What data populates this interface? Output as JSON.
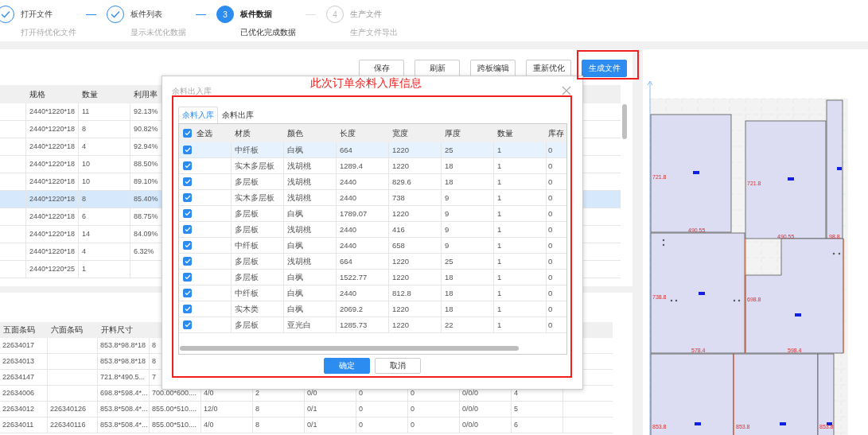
{
  "steps": [
    {
      "title": "打开文件",
      "subtitle": "打开待优化文件",
      "completed": true,
      "current": false
    },
    {
      "title": "板件列表",
      "subtitle": "显示未优化数据",
      "completed": true,
      "current": false
    },
    {
      "title": "板件数据",
      "subtitle": "已优化完成数据",
      "completed": false,
      "current": true,
      "number": "3"
    },
    {
      "title": "生产文件",
      "subtitle": "生产文件导出",
      "completed": false,
      "current": false,
      "number": "4"
    }
  ],
  "toolbar": [
    {
      "label": "保存",
      "kind": "default"
    },
    {
      "label": "刷新",
      "kind": "default"
    },
    {
      "label": "跨板编辑",
      "kind": "default"
    },
    {
      "label": "重新优化",
      "kind": "default"
    },
    {
      "label": "生成文件",
      "kind": "primary"
    }
  ],
  "board_table": {
    "columns": [
      "规格",
      "数量",
      "利用率"
    ],
    "rows": [
      {
        "cells": [
          "2440*1220*18",
          "11",
          "92.13%"
        ],
        "selected": false
      },
      {
        "cells": [
          "2440*1220*18",
          "8",
          "90.82%"
        ],
        "selected": false
      },
      {
        "cells": [
          "2440*1220*18",
          "4",
          "92.94%"
        ],
        "selected": false
      },
      {
        "cells": [
          "2440*1220*18",
          "10",
          "88.50%"
        ],
        "selected": false
      },
      {
        "cells": [
          "2440*1220*18",
          "10",
          "89.10%"
        ],
        "selected": false
      },
      {
        "cells": [
          "2440*1220*18",
          "8",
          "85.40%"
        ],
        "selected": true
      },
      {
        "cells": [
          "2440*1220*18",
          "6",
          "88.75%"
        ],
        "selected": false
      },
      {
        "cells": [
          "2440*1220*18",
          "14",
          "84.09%"
        ],
        "selected": false
      },
      {
        "cells": [
          "2440*1220*18",
          "4",
          "6.32%"
        ],
        "selected": false
      },
      {
        "cells": [
          "2440*1220*25",
          "1"
        ],
        "selected": false
      }
    ]
  },
  "part_table": {
    "columns": [
      "五面条码",
      "六面条码",
      "开料尺寸"
    ],
    "rows": [
      {
        "cells": [
          "22634017",
          null,
          "853.8*98.8*18",
          "8"
        ]
      },
      {
        "cells": [
          "22634013",
          null,
          "853.8*98.8*18",
          "8"
        ]
      },
      {
        "cells": [
          "22634147",
          null,
          "721.8*490.5...",
          "7"
        ]
      },
      {
        "cells": [
          "22634006",
          null,
          "698.8*598.4*...",
          "700.00*600....",
          "4/0",
          "2",
          "0/0",
          "0",
          "0",
          "0/0/0",
          "4"
        ]
      },
      {
        "cells": [
          "22634012",
          "226340126",
          "853.8*508.4*...",
          "855.00*510....",
          "12/0",
          "8",
          "0/1",
          "0",
          "0",
          "0/0/0",
          "5"
        ]
      },
      {
        "cells": [
          "22634011",
          "226340116",
          "853.8*508.4*...",
          "855.00*510....",
          "4/0",
          "8",
          "0/1",
          "0",
          "0",
          "0/0/0",
          "6"
        ]
      }
    ]
  },
  "modal": {
    "title": "余料出入库",
    "tabs": [
      {
        "label": "余料入库",
        "selected": true
      },
      {
        "label": "余料出库",
        "selected": false
      }
    ],
    "select_all": {
      "label": "全选",
      "checked": true
    },
    "columns": [
      "材质",
      "颜色",
      "长度",
      "宽度",
      "厚度",
      "数量",
      "库存"
    ],
    "rows": [
      {
        "checked": true,
        "selected": true,
        "cells": [
          "中纤板",
          "白枫",
          "664",
          "1220",
          "25",
          "1",
          "0"
        ]
      },
      {
        "checked": true,
        "selected": false,
        "cells": [
          "实木多层板",
          "浅胡桃",
          "1289.4",
          "1220",
          "18",
          "1",
          "0"
        ]
      },
      {
        "checked": true,
        "selected": false,
        "cells": [
          "多层板",
          "浅胡桃",
          "2440",
          "829.6",
          "18",
          "1",
          "0"
        ]
      },
      {
        "checked": true,
        "selected": false,
        "cells": [
          "实木多层板",
          "浅胡桃",
          "2440",
          "738",
          "9",
          "1",
          "0"
        ]
      },
      {
        "checked": true,
        "selected": false,
        "cells": [
          "多层板",
          "白枫",
          "1789.07",
          "1220",
          "9",
          "1",
          "0"
        ]
      },
      {
        "checked": true,
        "selected": false,
        "cells": [
          "多层板",
          "浅胡桃",
          "2440",
          "416",
          "9",
          "1",
          "0"
        ]
      },
      {
        "checked": true,
        "selected": false,
        "cells": [
          "中纤板",
          "白枫",
          "2440",
          "658",
          "9",
          "1",
          "0"
        ]
      },
      {
        "checked": true,
        "selected": false,
        "cells": [
          "多层板",
          "浅胡桃",
          "664",
          "1220",
          "25",
          "1",
          "0"
        ]
      },
      {
        "checked": true,
        "selected": false,
        "cells": [
          "多层板",
          "白枫",
          "1522.77",
          "1220",
          "18",
          "1",
          "0"
        ]
      },
      {
        "checked": true,
        "selected": false,
        "cells": [
          "中纤板",
          "白枫",
          "2440",
          "812.8",
          "18",
          "1",
          "0"
        ]
      },
      {
        "checked": true,
        "selected": false,
        "cells": [
          "实木类",
          "白枫",
          "2069.2",
          "1220",
          "18",
          "1",
          "0"
        ]
      },
      {
        "checked": true,
        "selected": false,
        "cells": [
          "多层板",
          "亚光白",
          "1285.73",
          "1220",
          "22",
          "1",
          "0"
        ]
      }
    ],
    "buttons": [
      {
        "label": "确定",
        "kind": "primary"
      },
      {
        "label": "取消",
        "kind": "default"
      }
    ]
  },
  "annotation": {
    "text": "此次订单余料入库信息"
  },
  "layout_labels": [
    "721.8",
    "490.55",
    "721.8",
    "490.55",
    "98.8",
    "738.8",
    "578.4",
    "698.8",
    "598.4",
    "853.8",
    "853.8",
    "853.8"
  ]
}
